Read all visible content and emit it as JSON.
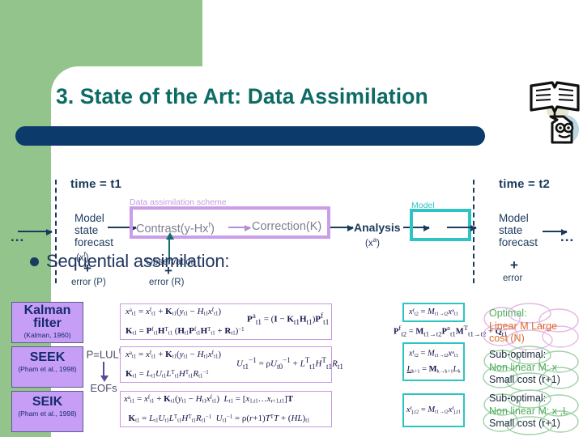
{
  "slide": {
    "title": "3. State of the Art: Data Assimilation",
    "title_color": "#0d6b65",
    "bar_color": "#0c3a6b",
    "panel_color": "#92c48c",
    "book_icon": "open-book-bookmark-icon"
  },
  "diagram": {
    "time_left": "time = t1",
    "time_right": "time = t2",
    "dots_left": "...",
    "dots_right": "...",
    "scheme_label": "Data assimilation scheme",
    "model_label": "Model",
    "forecast_left": {
      "l1": "Model",
      "l2": "state",
      "l3": "forecast",
      "value": "(xf)",
      "plus": "+",
      "error": "error (P)"
    },
    "forecast_right": {
      "l1": "Model",
      "l2": "state",
      "l3": "forecast",
      "plus": "+",
      "error": "error"
    },
    "contrast": "Contrast(y-Hxf)",
    "correction": "Correction(K)",
    "analysis": "Analysis",
    "analysis_value": "(xa)",
    "observation": "Observation",
    "obs_plus": "+",
    "obs_error": "error (R)",
    "bullet": "Sequential assimilation:"
  },
  "methods": [
    {
      "name": "Kalman filter",
      "ref": "(Kalman, 1960)"
    },
    {
      "name": "SEEK",
      "ref": "(Pham et al., 1998)"
    },
    {
      "name": "SEIK",
      "ref": "(Pham et al., 1998)"
    }
  ],
  "eof": {
    "formula": "P=LULt",
    "arrow": "down-arrow-icon",
    "result": "EOFs"
  },
  "equations": {
    "analysis": [
      {
        "line1": "xa t1 = xf t1 + Kt1(yt1 - Ht1 xf t1)",
        "line2": "Kt1 = Pf t1 HT t1 (Ht1 Pf t1 HT t1 + Rt1)-1",
        "extra": "Pa t1 = (I - Kt1 Ht1) Pf t1"
      },
      {
        "line1": "xa t1 = xf t1 + Kt1(yt1 - Ht1 xf t1)",
        "line2": "Kt1 = Lt1 Ut1 LT t1 HT t1 R-1 t1",
        "extra": "U-1 t1 = ρU-1 t0 + LT t1 HT t1 Rt1"
      },
      {
        "line1": "xa t1 = xf t1 + Kt1(yt1 - Ht1 xf t1)",
        "line2": "Kt1 = Lt1 Ut1 LT t1 HT t1 R-1 t1",
        "extra1": "Lt1 = [x1,t1 ... xr+1,t1] T",
        "extra2": "U-1 t1 = ρ(r+1)TTT + (HL)t1"
      }
    ],
    "forecast": [
      {
        "line1": "xf t2 = Mt1→t2 xa t1",
        "line2": "Pf t2 = Mt1→t2 Pa t1 MT t1→t2 + Qt1"
      },
      {
        "line1": "xf t2 = Mt1→t2 xa t1",
        "line2": "Lk+1 = Mk→k+1 Lk"
      },
      {
        "line1": "xf j,t2 = Mt1→t2 xf j,t1"
      }
    ]
  },
  "clouds": [
    {
      "l1": "Optimal:",
      "l1_color": "#4fae5a",
      "l2": "Linear M Large",
      "l3": "cost (N)",
      "body_color": "#e06b2a"
    },
    {
      "l1": "Sub-optimal:",
      "l1_color": "#1b2a3a",
      "l2": "Non linear M: x",
      "l2_color": "#4fae5a",
      "l3": "Small cost (r+1)",
      "l3_color": "#1b2a3a"
    },
    {
      "l1": "Sub-optimal:",
      "l1_color": "#1b2a3a",
      "l2": "Non linear M: x ,L",
      "l2_color": "#4fae5a",
      "l3": "Small cost (r+1)",
      "l3_color": "#1b2a3a"
    }
  ]
}
